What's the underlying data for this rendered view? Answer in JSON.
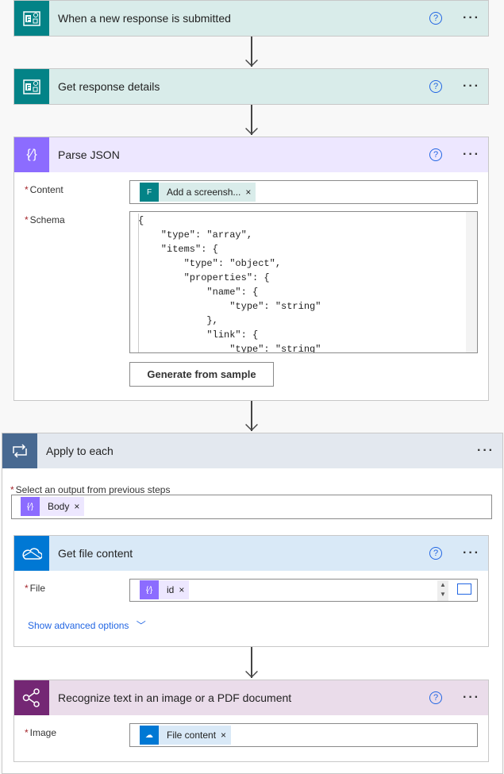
{
  "steps": {
    "trigger": {
      "title": "When a new response is submitted",
      "color": "#038387"
    },
    "details": {
      "title": "Get response details",
      "color": "#038387"
    },
    "parse": {
      "title": "Parse JSON",
      "color": "#8c6cff",
      "content_label": "Content",
      "content_token": "Add a screensh...",
      "schema_label": "Schema",
      "generate_button": "Generate from sample",
      "schema_lines": [
        "{",
        "    \"type\": \"array\",",
        "    \"items\": {",
        "        \"type\": \"object\",",
        "        \"properties\": {",
        "            \"name\": {",
        "                \"type\": \"string\"",
        "            },",
        "            \"link\": {",
        "                \"type\": \"string\""
      ]
    },
    "apply": {
      "title": "Apply to each",
      "color": "#486991",
      "select_label": "Select an output from previous steps",
      "token": "Body"
    },
    "file": {
      "title": "Get file content",
      "color": "#0078d4",
      "file_label": "File",
      "token": "id",
      "advanced": "Show advanced options"
    },
    "ocr": {
      "title": "Recognize text in an image or a PDF document",
      "color": "#742774",
      "image_label": "Image",
      "token": "File content"
    }
  },
  "common": {
    "required": "*",
    "remove": "×",
    "help": "?",
    "more": "···"
  }
}
